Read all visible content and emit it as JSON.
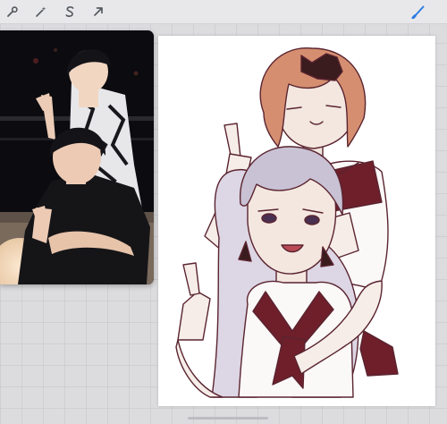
{
  "toolbar": {
    "tools": [
      {
        "name": "actions",
        "icon": "wrench-icon"
      },
      {
        "name": "adjustments",
        "icon": "magic-wand-icon"
      },
      {
        "name": "selection",
        "icon": "selection-s-icon"
      },
      {
        "name": "transform",
        "icon": "arrow-cursor-icon"
      }
    ],
    "active_tool": {
      "name": "brush",
      "icon": "brush-icon",
      "color": "#2a7ae4"
    }
  },
  "colors": {
    "accent": "#2a7ae4",
    "canvas": "#ffffff",
    "line_art": "#5a2430",
    "uniform_dark": "#6e1f2a"
  }
}
